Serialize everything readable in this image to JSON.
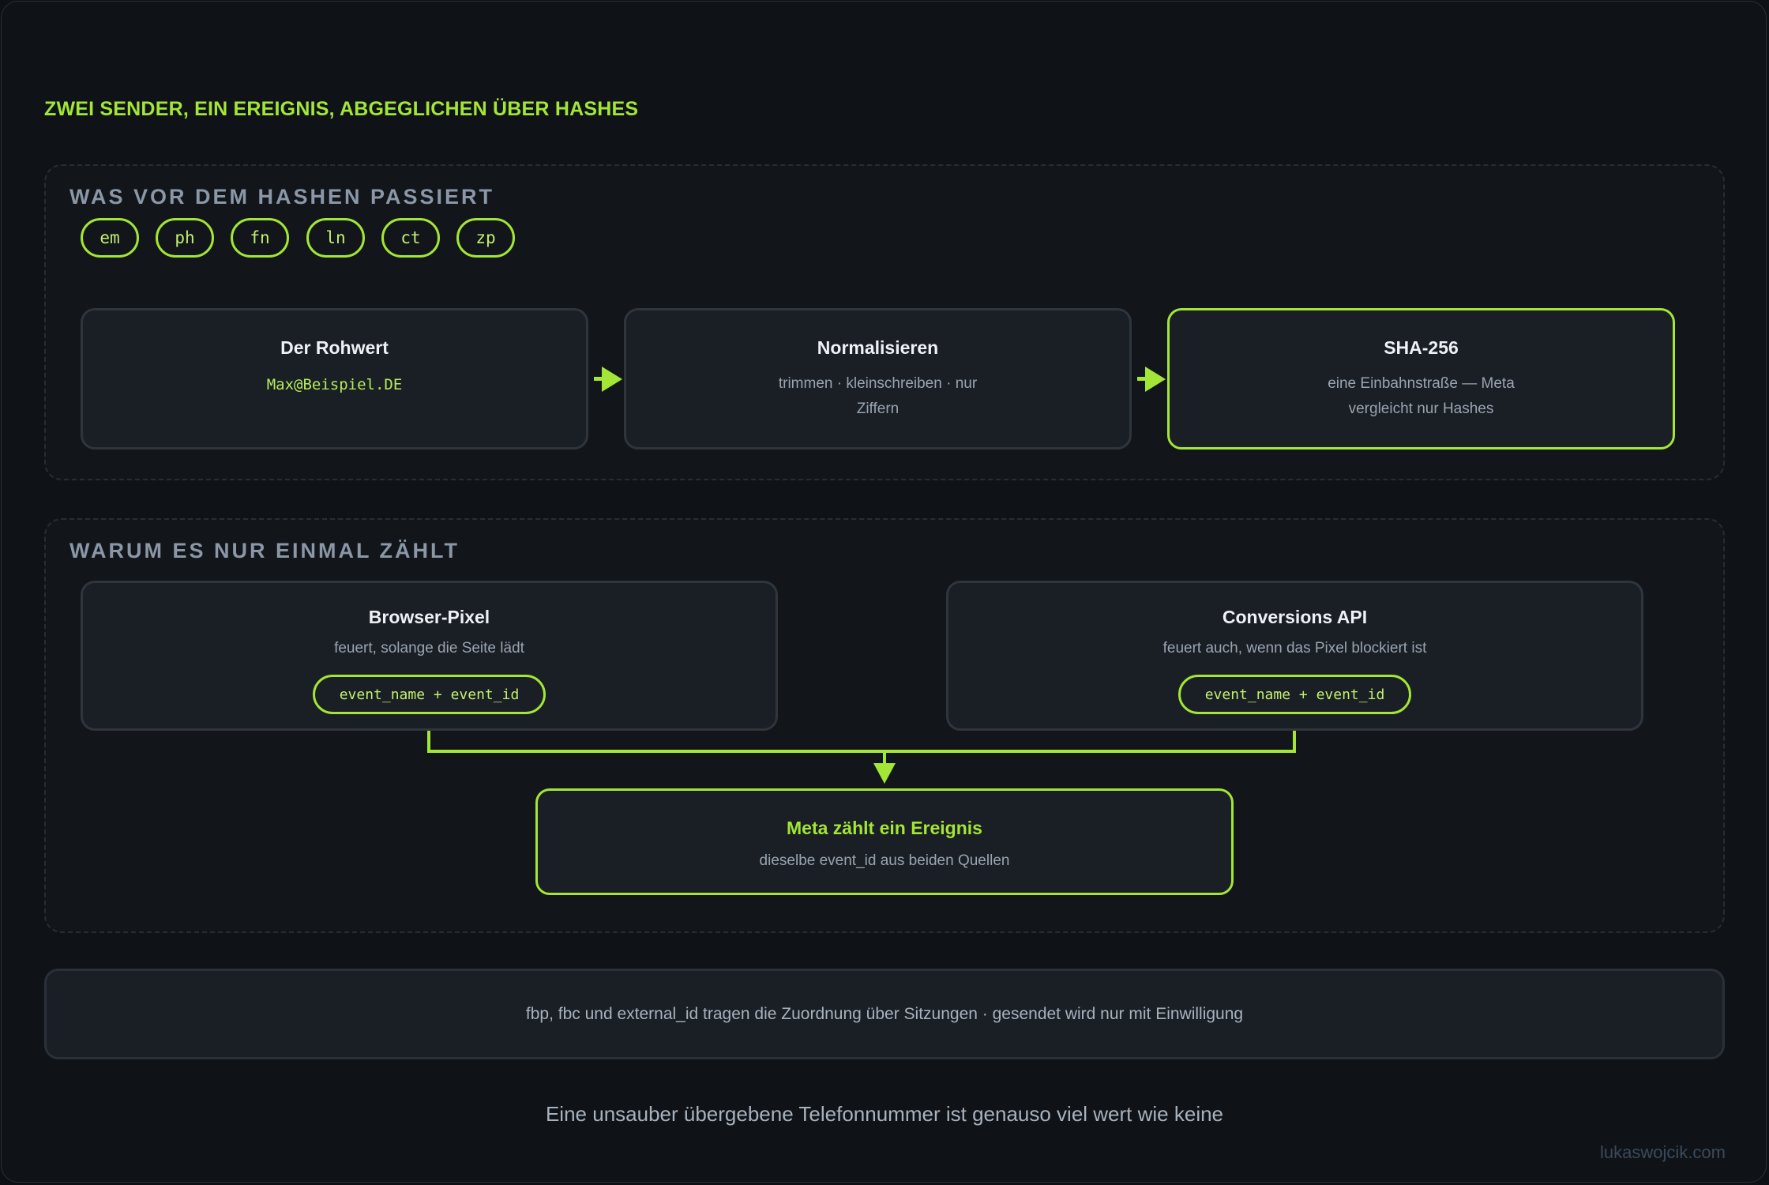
{
  "title": "ZWEI SENDER, EIN EREIGNIS, ABGEGLICHEN ÜBER HASHES",
  "section1": {
    "title": "WAS VOR DEM HASHEN PASSIERT",
    "chips": [
      "em",
      "ph",
      "fn",
      "ln",
      "ct",
      "zp"
    ],
    "steps": [
      {
        "title": "Der Rohwert",
        "value": "Max@Beispiel.DE"
      },
      {
        "title": "Normalisieren",
        "line1": "trimmen · kleinschreiben · nur",
        "line2": "Ziffern"
      },
      {
        "title": "SHA-256",
        "line1": "eine Einbahnstraße — Meta",
        "line2": "vergleicht nur Hashes"
      }
    ]
  },
  "section2": {
    "title": "WARUM ES NUR EINMAL ZÄHLT",
    "sources": [
      {
        "title": "Browser-Pixel",
        "subtitle": "feuert, solange die Seite lädt",
        "tag": "event_name + event_id"
      },
      {
        "title": "Conversions API",
        "subtitle": "feuert auch, wenn das Pixel blockiert ist",
        "tag": "event_name + event_id"
      }
    ],
    "result": {
      "title": "Meta zählt ein Ereignis",
      "subtitle": "dieselbe event_id aus beiden Quellen"
    }
  },
  "footer_note": "fbp, fbc und external_id tragen die Zuordnung über Sitzungen · gesendet wird nur mit Einwilligung",
  "tagline": "Eine unsauber übergebene Telefonnummer ist genauso viel wert wie keine",
  "credit": "lukaswojcik.com",
  "colors": {
    "accent": "#a3e635",
    "background": "#0f1317",
    "card": "#1a1f25"
  }
}
